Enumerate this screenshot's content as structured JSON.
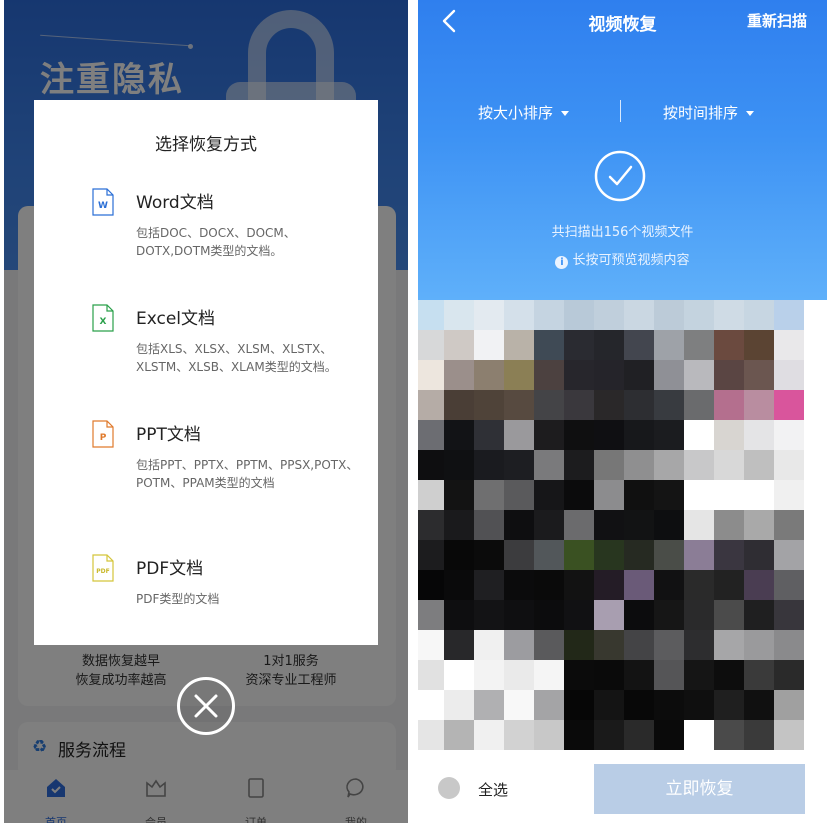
{
  "left": {
    "banner_title": "注重隐私",
    "info_left": [
      "数据恢复越早",
      "恢复成功率越高"
    ],
    "info_right": [
      "1对1服务",
      "资深专业工程师"
    ],
    "flow_title": "服务流程",
    "tabs": [
      {
        "label": "首页",
        "icon": "home-icon",
        "active": true
      },
      {
        "label": "会员",
        "icon": "crown-icon",
        "active": false
      },
      {
        "label": "订单",
        "icon": "order-icon",
        "active": false
      },
      {
        "label": "我的",
        "icon": "chat-icon",
        "active": false
      }
    ],
    "modal": {
      "title": "选择恢复方式",
      "options": [
        {
          "name": "Word文档",
          "desc": "包括DOC、DOCX、DOCM、DOTX,DOTM类型的文档。",
          "icon_letter": "W",
          "color": "#2b6fd6"
        },
        {
          "name": "Excel文档",
          "desc": "包括XLS、XLSX、XLSM、XLSTX、XLSTM、XLSB、XLAM类型的文档。",
          "icon_letter": "X",
          "color": "#2aa04a"
        },
        {
          "name": "PPT文档",
          "desc": "包括PPT、PPTX、PPTM、PPSX,POTX、POTM、PPAM类型的文档",
          "icon_letter": "P",
          "color": "#e07a2c"
        },
        {
          "name": "PDF文档",
          "desc": "PDF类型的文档",
          "icon_letter": "PDF",
          "color": "#d4c53a"
        }
      ]
    }
  },
  "right": {
    "title": "视频恢复",
    "rescan": "重新扫描",
    "sort_size": "按大小排序",
    "sort_time": "按时间排序",
    "scan_result": "共扫描出156个视频文件",
    "hint": "长按可预览视频内容",
    "select_all": "全选",
    "recover_button": "立即恢复"
  },
  "colors": {
    "accent_blue": "#2f7fee",
    "recover_disabled": "#b9cde6"
  },
  "mosaic": [
    "#c6dff0",
    "#d9e6ee",
    "#e3eaf0",
    "#d4e0ea",
    "#c5d4e1",
    "#b8c9d8",
    "#c0cfdc",
    "#cad7e2",
    "#bccbd8",
    "#c4d3df",
    "#cfdbe5",
    "#c7d6e2",
    "#b9d0ea",
    "#d7d8d9",
    "#cfc9c5",
    "#f1f2f4",
    "#b9b2a8",
    "#3f4a55",
    "#2a2b31",
    "#25262b",
    "#43464f",
    "#9ea2a8",
    "#7e7f80",
    "#6b4a3f",
    "#5b4433",
    "#e9e8ea",
    "#ede6de",
    "#9b8f8b",
    "#8c7f6f",
    "#8b7f55",
    "#4c4140",
    "#27262c",
    "#25242a",
    "#202024",
    "#8f9096",
    "#b9b9bd",
    "#5a4543",
    "#6b5650",
    "#dfdde2",
    "#b5aca6",
    "#4a3e36",
    "#4f4339",
    "#574a40",
    "#444447",
    "#3a383d",
    "#2a2829",
    "#2d2e32",
    "#383b40",
    "#6a6b6d",
    "#b46f8e",
    "#b98da0",
    "#d9559c",
    "#6c6d72",
    "#121316",
    "#2f3036",
    "#9a999c",
    "#1d1c1e",
    "#0f0f10",
    "#0f0f12",
    "#17181b",
    "#1b1c1f",
    "#ffffff",
    "#d8d5d1",
    "#e4e4e6",
    "#f2f2f3",
    "#0e0e10",
    "#0f1012",
    "#1a1b1f",
    "#1d1e22",
    "#7a7a7c",
    "#1c1c1e",
    "#777777",
    "#8f8f90",
    "#a7a7a8",
    "#c8c8c9",
    "#d8d8d8",
    "#bfbfbf",
    "#e8e8e8",
    "#cfcfcf",
    "#131313",
    "#6f6f70",
    "#5a5a5c",
    "#161618",
    "#0b0b0c",
    "#8c8c8e",
    "#101010",
    "#141414",
    "#ffffff",
    "#ffffff",
    "#ffffff",
    "#f0f0f0",
    "#2c2c2e",
    "#1a1a1c",
    "#515154",
    "#0e0e10",
    "#1b1b1d",
    "#6b6b6d",
    "#111113",
    "#121314",
    "#0d0e10",
    "#e5e5e5",
    "#8c8c8c",
    "#a9a9a9",
    "#7a7a7a",
    "#1c1c1e",
    "#080808",
    "#0b0b0b",
    "#3c3c3e",
    "#52575a",
    "#3a5122",
    "#28361f",
    "#262a22",
    "#4a4d48",
    "#8b7d96",
    "#3a3640",
    "#2f2d33",
    "#a3a3a6",
    "#060607",
    "#0a0a0b",
    "#1f1f22",
    "#0b0b0c",
    "#0a0a0a",
    "#121212",
    "#241c26",
    "#6a5a78",
    "#111112",
    "#2a2a2a",
    "#222222",
    "#4a3d52",
    "#5f5f62",
    "#7d7d7f",
    "#0e0e10",
    "#131315",
    "#0f0f11",
    "#0c0c0d",
    "#111113",
    "#a89eb0",
    "#0c0c0d",
    "#161616",
    "#2a2a2b",
    "#4b4b4b",
    "#1f1f20",
    "#38363c",
    "#f7f7f7",
    "#28282a",
    "#f0f0f0",
    "#9c9ca0",
    "#5a5a5c",
    "#222818",
    "#38382f",
    "#444446",
    "#5c5c5e",
    "#2d2d2f",
    "#a6a6a8",
    "#9a9a9c",
    "#8a8a8c",
    "#e1e1e1",
    "#ffffff",
    "#f3f3f3",
    "#eaeaea",
    "#f5f5f5",
    "#0b0b0b",
    "#0a0a0a",
    "#131313",
    "#555557",
    "#151515",
    "#0d0d0d",
    "#3a3a3a",
    "#2a2a2a",
    "#ffffff",
    "#ececec",
    "#b0b0b2",
    "#f8f8f8",
    "#a4a4a6",
    "#060606",
    "#141414",
    "#080808",
    "#0c0c0c",
    "#0f0f0f",
    "#1f1f1f",
    "#101010",
    "#a0a0a0",
    "#e5e5e5",
    "#b4b4b4",
    "#f0f0f0",
    "#d2d2d2",
    "#c8c8c8",
    "#0a0a0a",
    "#1a1a1a",
    "#2a2a2a",
    "#0a0a0a",
    "#ffffff",
    "#4a4a4a",
    "#3a3a3a",
    "#c4c4c4"
  ]
}
